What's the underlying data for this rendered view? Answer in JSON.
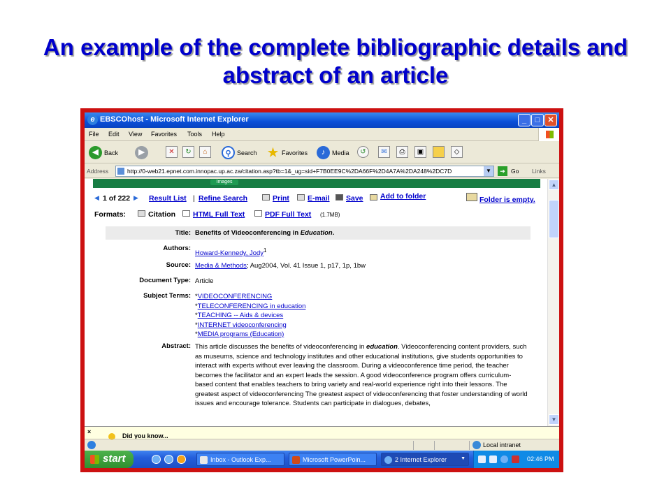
{
  "slide": {
    "title_line1": "An example of the complete bibliographic details and",
    "title_line2": "abstract of an article"
  },
  "window": {
    "title": "EBSCOhost - Microsoft Internet Explorer",
    "controls": {
      "minimize": "_",
      "maximize": "□",
      "close": "✕"
    }
  },
  "menu": [
    "File",
    "Edit",
    "View",
    "Favorites",
    "Tools",
    "Help"
  ],
  "toolbar": {
    "back": "Back",
    "search": "Search",
    "favorites": "Favorites",
    "media": "Media"
  },
  "address": {
    "label": "Address",
    "url": "http://0-web21.epnet.com.innopac.up.ac.za/citation.asp?tb=1&_ug=sid+F7B0EE9C%2DA66F%2D4A7A%2DA248%2DC7D",
    "go": "Go",
    "links": "Links"
  },
  "page": {
    "green_tab": "Images",
    "nav": {
      "position": "1 of 222",
      "result_list": "Result List",
      "separator": "|",
      "refine_search": "Refine Search",
      "print": "Print",
      "email": "E-mail",
      "save": "Save",
      "add_to_folder": "Add to folder",
      "folder_status": "Folder is empty."
    },
    "formats": {
      "label": "Formats:",
      "citation": "Citation",
      "html_full_text": "HTML Full Text",
      "pdf_full_text": "PDF Full Text",
      "pdf_size": "(1.7MB)"
    },
    "record": {
      "title_label": "Title:",
      "title_value": "Benefits of Videoconferencing in ",
      "title_value_em": "Education",
      "title_value_end": ".",
      "authors_label": "Authors:",
      "author": "Howard-Kennedy, Jody",
      "author_sup": "1",
      "source_label": "Source:",
      "source_link": "Media & Methods",
      "source_rest": "; Aug2004, Vol. 41 Issue 1, p17, 1p, 1bw",
      "doctype_label": "Document Type:",
      "doctype_value": "Article",
      "subject_label": "Subject Terms:",
      "subjects": [
        "VIDEOCONFERENCING",
        "TELECONFERENCING in education",
        "TEACHING -- Aids & devices",
        "INTERNET videoconferencing",
        "MEDIA programs (Education)"
      ],
      "subject_prefix": "*",
      "abstract_label": "Abstract:",
      "abstract_start": "This article discusses the benefits of videoconferencing in ",
      "abstract_em": "education",
      "abstract_rest": ". Videoconferencing content providers, such as museums, science and technology institutes and other educational institutions, give students opportunities to interact with experts without ever leaving the classroom. During a videoconference time period, the teacher becomes the facilitator and an expert leads the session. A good videoconference program offers curriculum-based content that enables teachers to bring variety and real-world experience right into their lessons. The greatest aspect of videoconferencing The greatest aspect of videoconferencing that foster understanding of world issues and encourage tolerance. Students can participate in dialogues, debates,"
    }
  },
  "infobar": {
    "close": "×",
    "text": "Did you know..."
  },
  "status": {
    "zone": "Local intranet"
  },
  "taskbar": {
    "start": "start",
    "tasks": [
      "Inbox - Outlook Exp...",
      "Microsoft PowerPoin...",
      "2 Internet Explorer"
    ],
    "clock": "02:46 PM"
  }
}
